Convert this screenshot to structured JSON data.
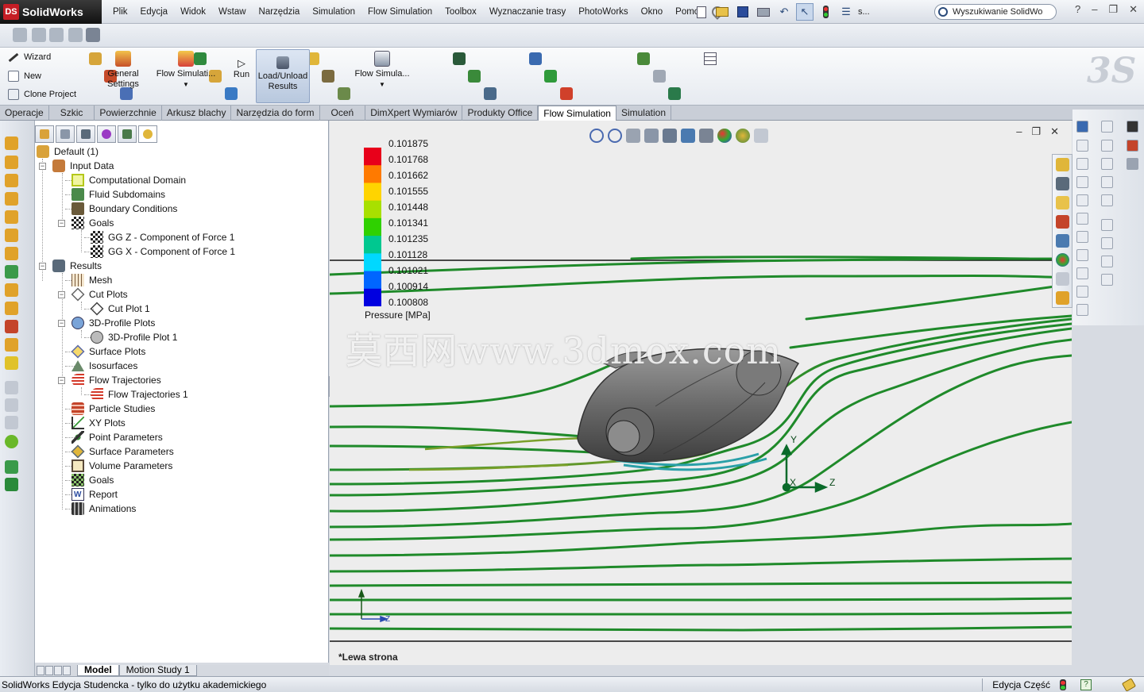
{
  "app": {
    "logo_text": "SolidWorks",
    "logo_mark": "DS"
  },
  "menu": [
    "Plik",
    "Edycja",
    "Widok",
    "Wstaw",
    "Narzędzia",
    "Simulation",
    "Flow Simulation",
    "Toolbox",
    "Wyznaczanie trasy",
    "PhotoWorks",
    "Okno",
    "Pomoc"
  ],
  "search": {
    "placeholder": "Wyszukiwanie SolidWo"
  },
  "quick_toolbar": {
    "more_label": "s..."
  },
  "command_manager": {
    "wizard_label": "Wizard",
    "new_label": "New",
    "clone_label": "Clone Project",
    "general_settings_label": "General Settings",
    "flow_sim_label": "Flow Simulati...",
    "run_label": "Run",
    "load_results_label": "Load/Unload Results",
    "flow_sim2_label": "Flow Simula..."
  },
  "tabs": [
    "Operacje",
    "Szkic",
    "Powierzchnie",
    "Arkusz blachy",
    "Narzędzia do form",
    "Oceń",
    "DimXpert Wymiarów",
    "Produkty Office",
    "Flow Simulation",
    "Simulation"
  ],
  "active_tab": "Flow Simulation",
  "tree": {
    "root": "Default (1)",
    "input_data": "Input Data",
    "computational_domain": "Computational Domain",
    "fluid_subdomains": "Fluid Subdomains",
    "boundary_conditions": "Boundary Conditions",
    "goals": "Goals",
    "goal_z": "GG Z - Component of Force 1",
    "goal_x": "GG X - Component of Force 1",
    "results": "Results",
    "mesh": "Mesh",
    "cut_plots": "Cut Plots",
    "cut_plot_1": "Cut Plot 1",
    "profile_plots": "3D-Profile Plots",
    "profile_plot_1": "3D-Profile Plot 1",
    "surface_plots": "Surface Plots",
    "isosurfaces": "Isosurfaces",
    "flow_trajectories": "Flow Trajectories",
    "flow_trajectories_1": "Flow Trajectories 1",
    "particle_studies": "Particle Studies",
    "xy_plots": "XY Plots",
    "point_parameters": "Point Parameters",
    "surface_parameters": "Surface Parameters",
    "volume_parameters": "Volume Parameters",
    "goals_results": "Goals",
    "report": "Report",
    "animations": "Animations"
  },
  "legend": {
    "values": [
      "0.101875",
      "0.101768",
      "0.101662",
      "0.101555",
      "0.101448",
      "0.101341",
      "0.101235",
      "0.101128",
      "0.101021",
      "0.100914",
      "0.100808"
    ],
    "title": "Pressure [MPa]",
    "colors": [
      "#e8001a",
      "#ff7a00",
      "#ffd400",
      "#a8e000",
      "#2fd100",
      "#00c890",
      "#00d8ff",
      "#0066ff",
      "#0000e0"
    ]
  },
  "viewport": {
    "view_name": "*Lewa strona",
    "watermark": "莫西网www.3dmox.com",
    "triad_y": "Y",
    "triad_x": "X",
    "triad_z": "Z",
    "corner_z": "Z"
  },
  "bottom_tabs": [
    "Model",
    "Motion Study 1"
  ],
  "status": {
    "left": "SolidWorks Edycja Studencka - tylko do użytku akademickiego",
    "mode": "Edycja Część"
  },
  "colors": {
    "stream": "#1f8a2a",
    "body": "#6e6e6e",
    "accent": "#c51d25"
  }
}
